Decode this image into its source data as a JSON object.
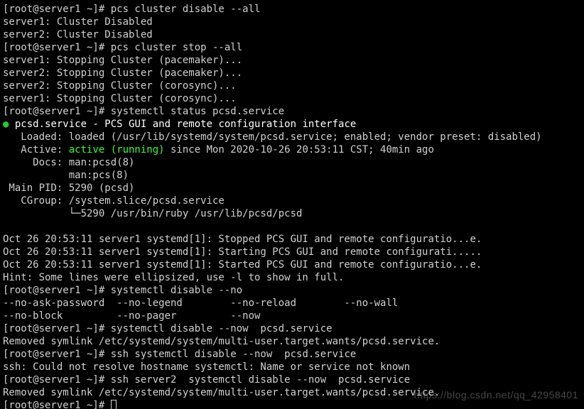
{
  "prompt": "[root@server1 ~]# ",
  "cmd": {
    "disable": "pcs cluster disable --all",
    "stop": "pcs cluster stop --all",
    "status": "systemctl status pcsd.service",
    "sysdisable_partial": "systemctl disable --no",
    "sysdisable_now": "systemctl disable --now  pcsd.service",
    "ssh_bad": "ssh systemctl disable --now  pcsd.service",
    "ssh_server2": "ssh server2  systemctl disable --now  pcsd.service"
  },
  "out": {
    "disable1": "server1: Cluster Disabled",
    "disable2": "server2: Cluster Disabled",
    "stop1": "server1: Stopping Cluster (pacemaker)...",
    "stop2": "server2: Stopping Cluster (pacemaker)...",
    "stop3": "server2: Stopping Cluster (corosync)...",
    "stop4": "server1: Stopping Cluster (corosync)...",
    "status_title": " pcsd.service - PCS GUI and remote configuration interface",
    "status_loaded": "   Loaded: loaded (/usr/lib/systemd/system/pcsd.service; enabled; vendor preset: disabled)",
    "status_active_pre": "   Active: ",
    "status_active_state": "active (running)",
    "status_active_post": " since Mon 2020-10-26 20:53:11 CST; 40min ago",
    "status_docs1": "     Docs: man:pcsd(8)",
    "status_docs2": "           man:pcs(8)",
    "status_pid": " Main PID: 5290 (pcsd)",
    "status_cgroup": "   CGroup: /system.slice/pcsd.service",
    "status_cg_line": "           └─5290 /usr/bin/ruby /usr/lib/pcsd/pcsd",
    "log1": "Oct 26 20:53:11 server1 systemd[1]: Stopped PCS GUI and remote configuratio...e.",
    "log2": "Oct 26 20:53:11 server1 systemd[1]: Starting PCS GUI and remote configurati.....",
    "log3": "Oct 26 20:53:11 server1 systemd[1]: Started PCS GUI and remote configuratio...e.",
    "hint": "Hint: Some lines were ellipsized, use -l to show in full.",
    "comp1": "--no-ask-password  --no-legend        --no-reload        --no-wall",
    "comp2": "--no-block         --no-pager         --now",
    "removed": "Removed symlink /etc/systemd/system/multi-user.target.wants/pcsd.service.",
    "ssh_err": "ssh: Could not resolve hostname systemctl: Name or service not known"
  },
  "watermark": "https://blog.csdn.net/qq_42958401"
}
